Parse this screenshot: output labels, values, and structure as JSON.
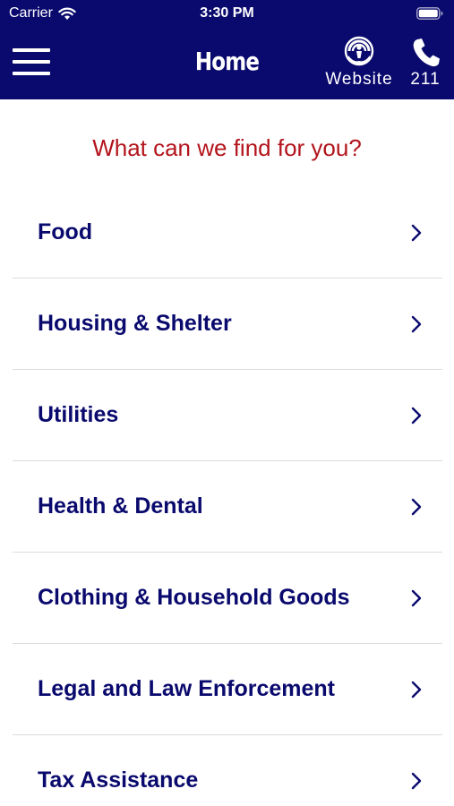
{
  "status_bar": {
    "carrier": "Carrier",
    "time": "3:30 PM",
    "icons": [
      "wifi-icon",
      "battery-icon"
    ]
  },
  "nav": {
    "title": "Home",
    "website_label": "Website",
    "call_label": "211",
    "icons": [
      "menu-icon",
      "united-way-logo-icon",
      "phone-icon"
    ]
  },
  "prompt": "What can we find for you?",
  "categories": [
    "Food",
    "Housing & Shelter",
    "Utilities",
    "Health & Dental",
    "Clothing & Household Goods",
    "Legal and Law Enforcement",
    "Tax Assistance"
  ],
  "colors": {
    "header_background": "#0a0a6e",
    "category_text": "#0a0a6e",
    "prompt_text": "#b3141c",
    "divider": "#dcdcdc"
  }
}
